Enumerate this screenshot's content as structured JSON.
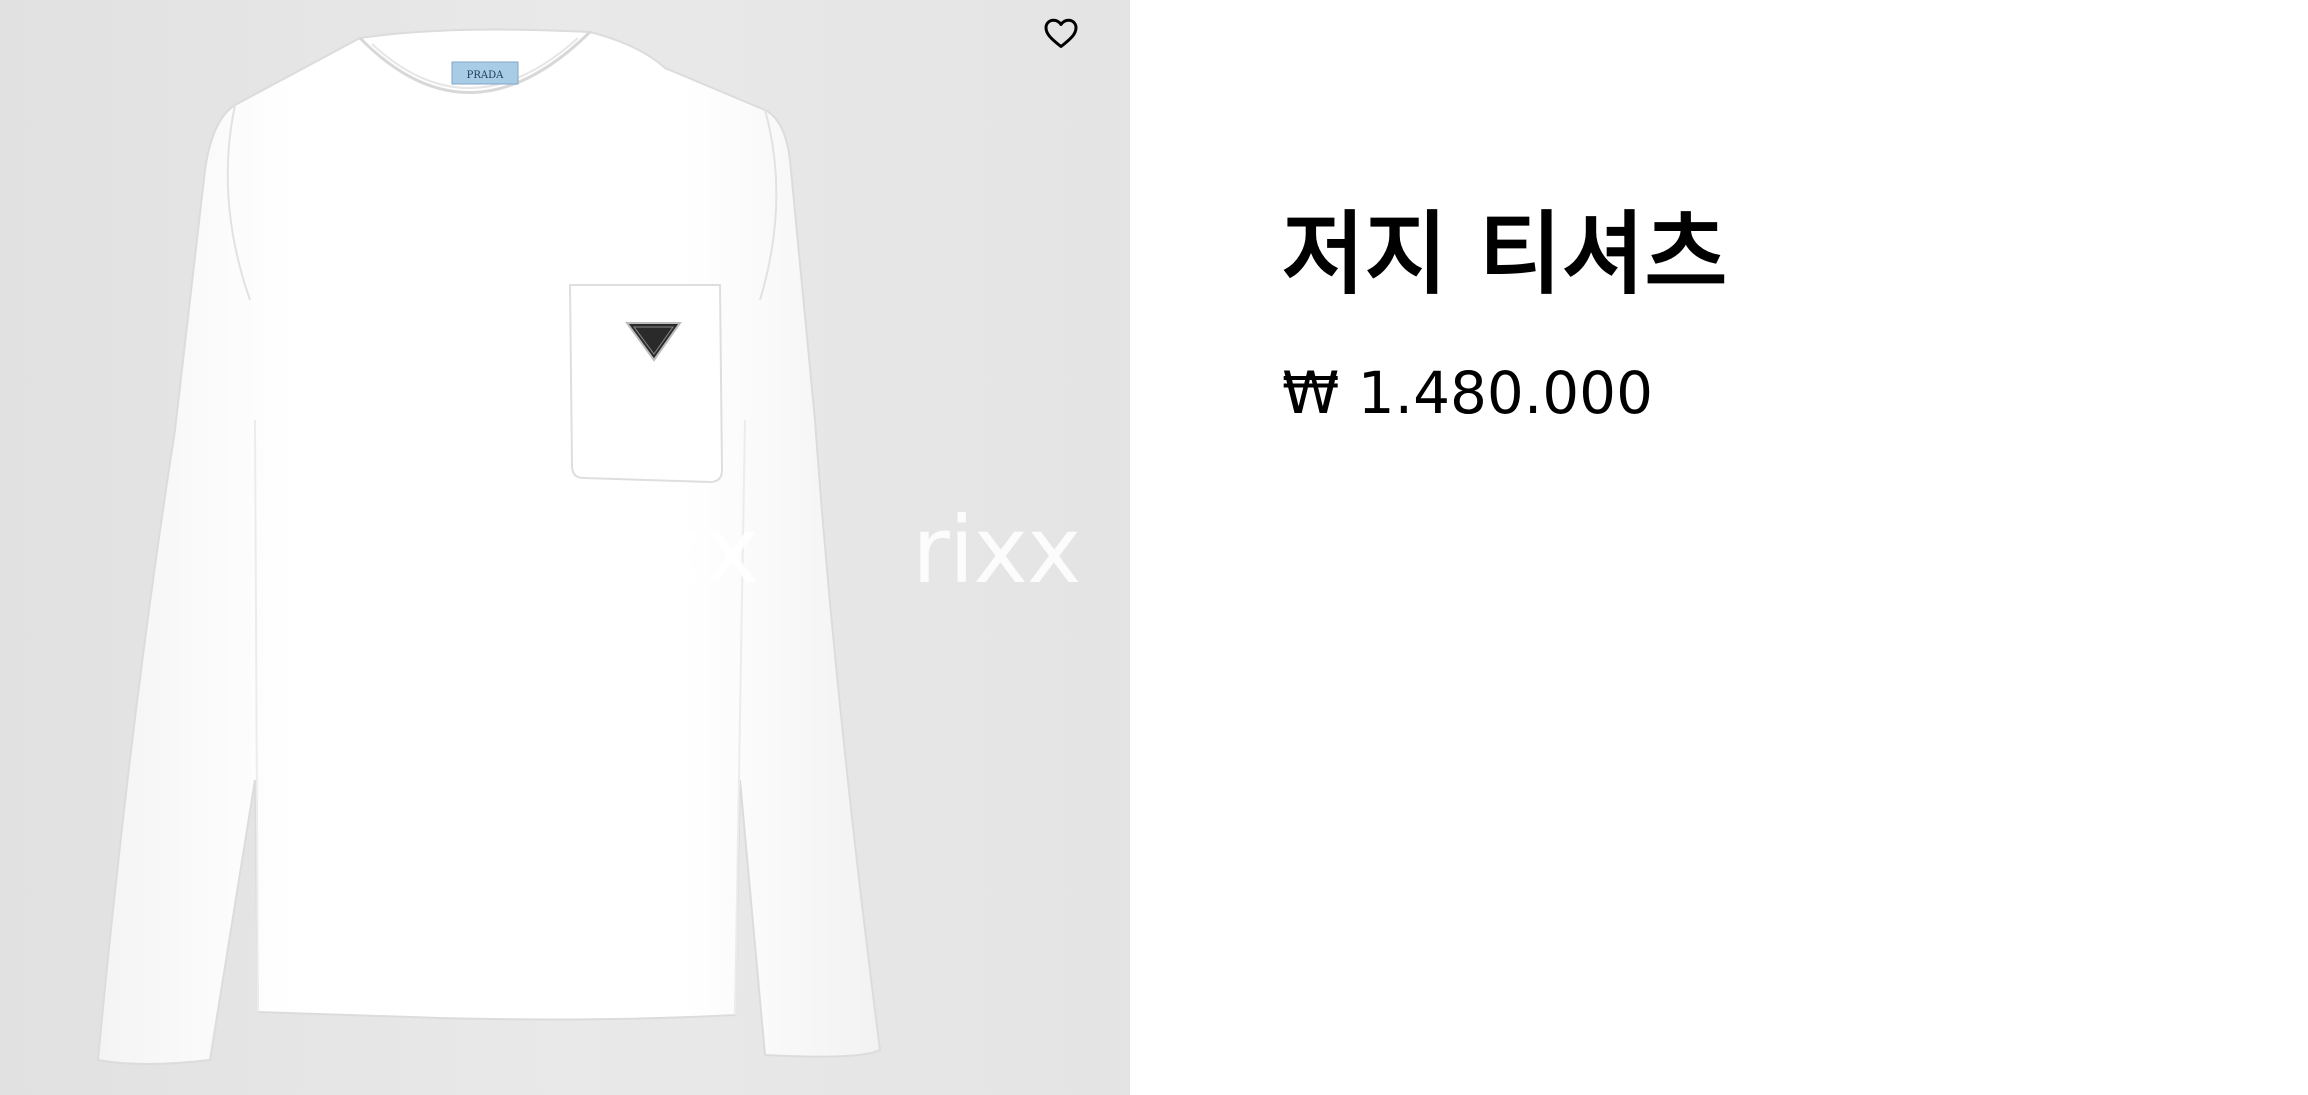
{
  "product": {
    "title": "저지 티셔츠",
    "price": "₩ 1.480.000",
    "label_text": "PRADA",
    "watermarks": [
      "rixx",
      "rixx"
    ]
  },
  "icons": {
    "wishlist": "heart-outline-icon",
    "pocket_logo": "triangle-logo-icon"
  },
  "colors": {
    "background_image": "#e6e6e6",
    "shirt": "#ffffff",
    "label": "#a8cbe6",
    "logo": "#2a2a2a",
    "text": "#000000"
  }
}
